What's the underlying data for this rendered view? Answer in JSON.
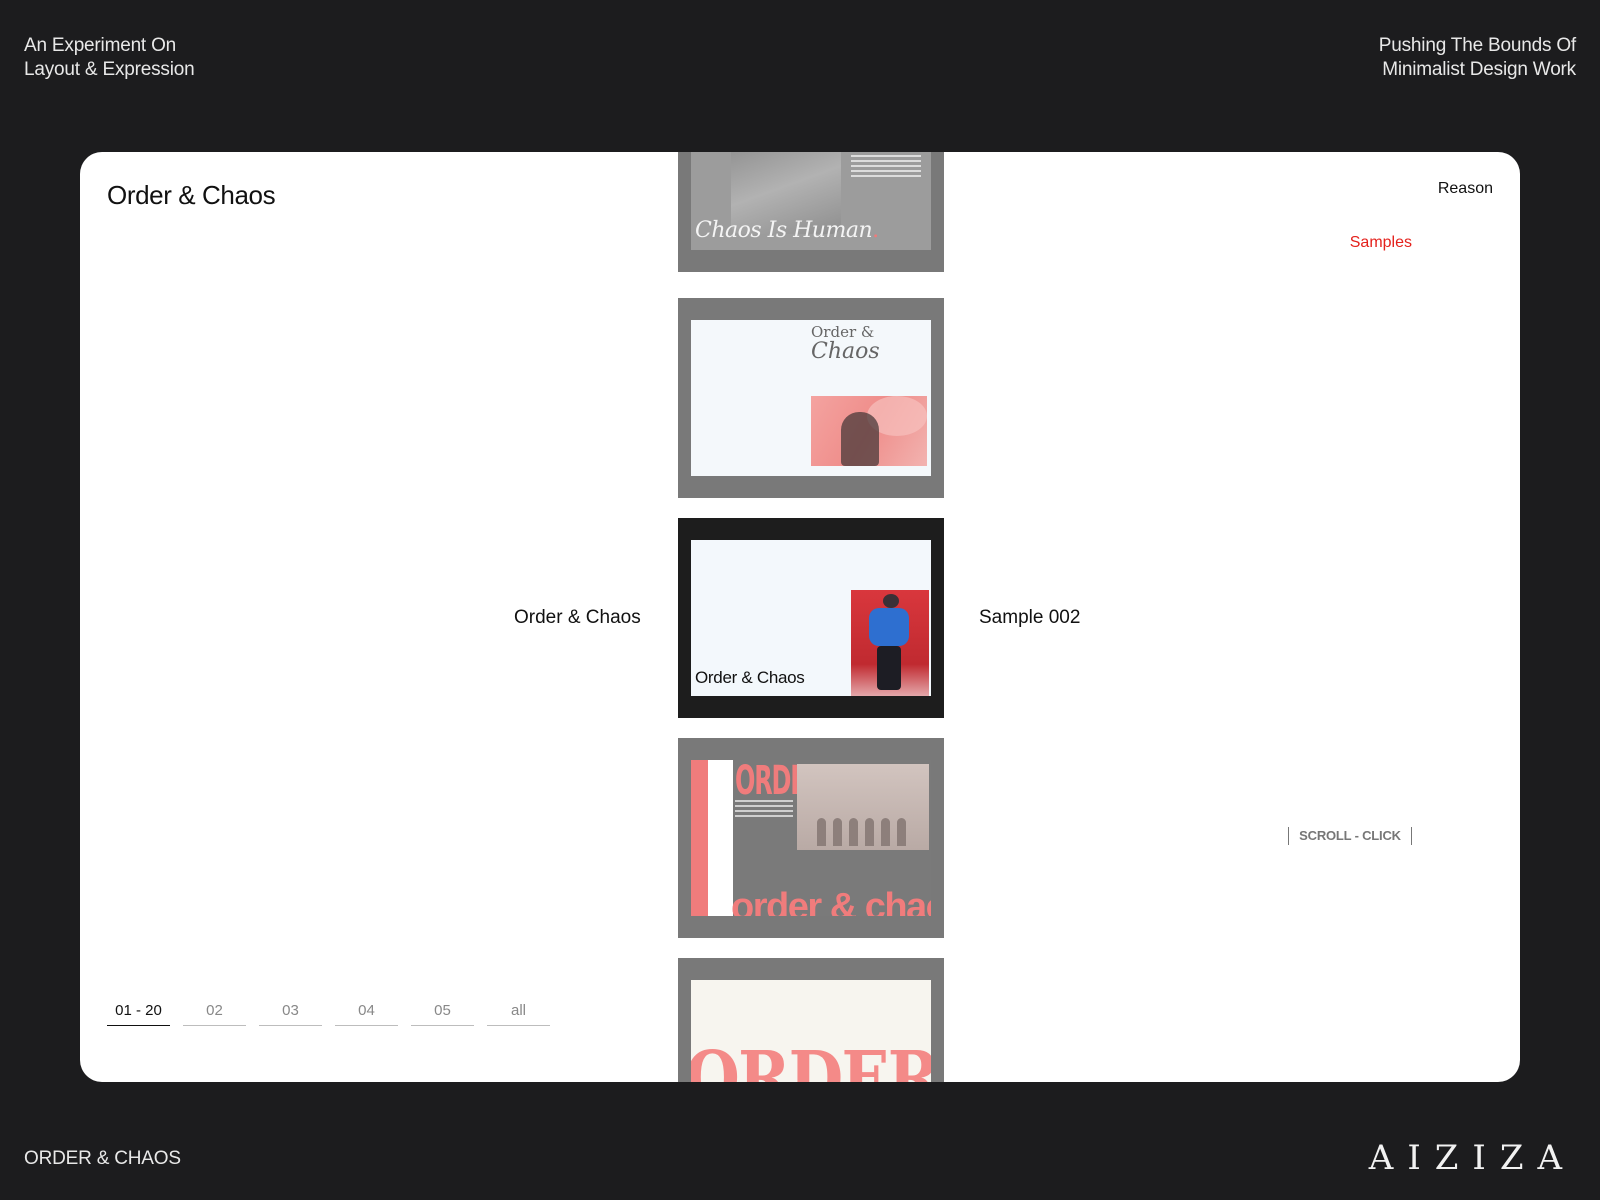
{
  "header": {
    "left_line1": "An Experiment On",
    "left_line2": "Layout & Expression",
    "right_line1": "Pushing The Bounds Of",
    "right_line2": "Minimalist Design Work"
  },
  "card": {
    "title": "Order & Chaos",
    "nav": {
      "reason": "Reason",
      "samples": "Samples"
    },
    "left_label": "Order & Chaos",
    "right_label": "Sample 002",
    "scroll_hint": "SCROLL - CLICK",
    "pager": [
      "01 - 20",
      "02",
      "03",
      "04",
      "05",
      "all"
    ]
  },
  "slides": {
    "s1_script": "Chaos Is Human",
    "s1_dot": ".",
    "s2_head_line1": "Order &",
    "s2_head_line2": "Chaos",
    "s3_title": "Order & Chaos",
    "s4_order": "ORDER",
    "s4_big": "order & chao",
    "s5_big": "ORDER"
  },
  "footer": {
    "title": "ORDER & CHAOS",
    "logo": "AIZIZA"
  },
  "colors": {
    "background": "#1c1c1e",
    "card": "#ffffff",
    "accent_red": "#e4211c",
    "coral": "#f07c7c"
  }
}
